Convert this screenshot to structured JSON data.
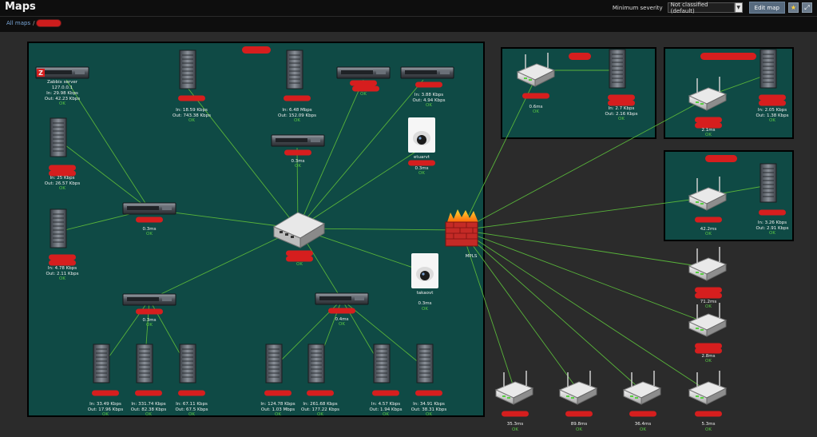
{
  "header": {
    "title": "Maps",
    "severity_label": "Minimum severity",
    "severity_value": "Not classified (default)",
    "edit_label": "Edit map",
    "favorite_icon": "star-icon",
    "fullscreen_icon": "fullscreen-icon"
  },
  "breadcrumb": {
    "all_maps": "All maps",
    "separator": "/"
  },
  "colors": {
    "link": "#58b33a",
    "ok": "#58c845",
    "panel": "#0f4a45",
    "redacted": "#d61e1e"
  },
  "nodes": {
    "zabbix": {
      "name": "Zabbix server",
      "ip": "127.0.0.1",
      "in": "In: 29.98 Kbps",
      "out": "Out: 42.23 Kbps",
      "status": "OK"
    },
    "srv_top1": {
      "in": "In: 18.59 Kbps",
      "out": "Out: 743.38 Kbps",
      "status": "OK"
    },
    "srv_top2": {
      "in": "In: 6.48 Mbps",
      "out": "Out: 152.09 Kbps",
      "status": "OK"
    },
    "rack_top3": {
      "status": "OK"
    },
    "rack_top4": {
      "in": "In: 3.88 Kbps",
      "out": "Out: 4.94 Kbps",
      "status": "OK"
    },
    "rack_mid": {
      "ms": "0.3ms",
      "status": "OK"
    },
    "cam1": {
      "name": "etuarvt",
      "ms": "0.3ms",
      "status": "OK"
    },
    "srv_left2": {
      "in": "In: 25 Kbps",
      "out": "Out: 26.57 Kbps",
      "status": "OK"
    },
    "rack_left": {
      "ms": "0.3ms",
      "status": "OK"
    },
    "srv_left3": {
      "in": "In: 4.78 Kbps",
      "out": "Out: 2.11 Kbps",
      "status": "OK"
    },
    "switch": {
      "status": "OK"
    },
    "cam2": {
      "name": "takaovt",
      "ms": "0.3ms",
      "status": "OK"
    },
    "firewall": {
      "name": "MPLS"
    },
    "rack_bl": {
      "ms": "0.3ms",
      "status": "OK"
    },
    "rack_bc": {
      "ms": "0.4ms",
      "status": "OK"
    },
    "b1": {
      "in": "In: 33.49 Kbps",
      "out": "Out: 17.96 Kbps",
      "status": "OK"
    },
    "b2": {
      "in": "In: 331.74 Kbps",
      "out": "Out: 82.38 Kbps",
      "status": "OK"
    },
    "b3": {
      "in": "In: 67.11 Kbps",
      "out": "Out: 67.5 Kbps",
      "status": "OK"
    },
    "b4": {
      "in": "In: 124.78 Kbps",
      "out": "Out: 1.03 Mbps",
      "status": "OK"
    },
    "b5": {
      "in": "In: 261.68 Kbps",
      "out": "Out: 177.22 Kbps",
      "status": "OK"
    },
    "b6": {
      "in": "In: 4.57 Kbps",
      "out": "Out: 1.94 Kbps",
      "status": "OK"
    },
    "b7": {
      "in": "In: 34.91 Kbps",
      "out": "Out: 38.31 Kbps",
      "status": "OK"
    },
    "p1_router": {
      "ms": "0.6ms",
      "status": "OK"
    },
    "p1_server": {
      "in": "In: 2.7 Kbps",
      "out": "Out: 2.16 Kbps",
      "status": "OK"
    },
    "p2_router": {
      "ms": "2.1ms",
      "status": "OK"
    },
    "p2_server": {
      "in": "In: 2.05 Kbps",
      "out": "Out: 1.38 Kbps",
      "status": "OK"
    },
    "p3_router": {
      "ms": "42.2ms",
      "status": "OK"
    },
    "p3_server": {
      "in": "In: 3.26 Kbps",
      "out": "Out: 2.91 Kbps",
      "status": "OK"
    },
    "r1": {
      "ms": "71.2ms",
      "status": "OK"
    },
    "r2": {
      "ms": "2.8ms",
      "status": "OK"
    },
    "r3": {
      "ms": "35.3ms",
      "status": "OK"
    },
    "r4": {
      "ms": "89.8ms",
      "status": "OK"
    },
    "r5": {
      "ms": "36.4ms",
      "status": "OK"
    },
    "r6": {
      "ms": "5.3ms",
      "status": "OK"
    }
  }
}
